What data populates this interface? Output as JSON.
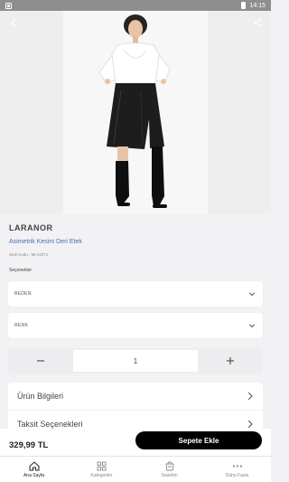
{
  "status_bar": {
    "time": "14:15"
  },
  "product": {
    "brand": "LARANOR",
    "name": "Asimetrik Kesim Deri Etek",
    "sku": "Stok Kodu : 98.41071",
    "options_label": "Seçenekler",
    "size_placeholder": "BEDEN",
    "color_placeholder": "RENK",
    "quantity": "1",
    "price": "329,99 TL",
    "add_to_cart_label": "Sepete Ekle"
  },
  "accordion": {
    "items": [
      {
        "label": "Ürün Bilgileri"
      },
      {
        "label": "Taksit Seçenekleri"
      }
    ]
  },
  "tab_bar": {
    "items": [
      {
        "label": "Ana Sayfa",
        "icon": "home-icon"
      },
      {
        "label": "Kategoriler",
        "icon": "grid-icon"
      },
      {
        "label": "Sepetim",
        "icon": "cart-icon"
      },
      {
        "label": "Daha Fazla",
        "icon": "more-icon"
      }
    ]
  },
  "colors": {
    "accent": "#000000",
    "link": "#4a6ea8"
  }
}
